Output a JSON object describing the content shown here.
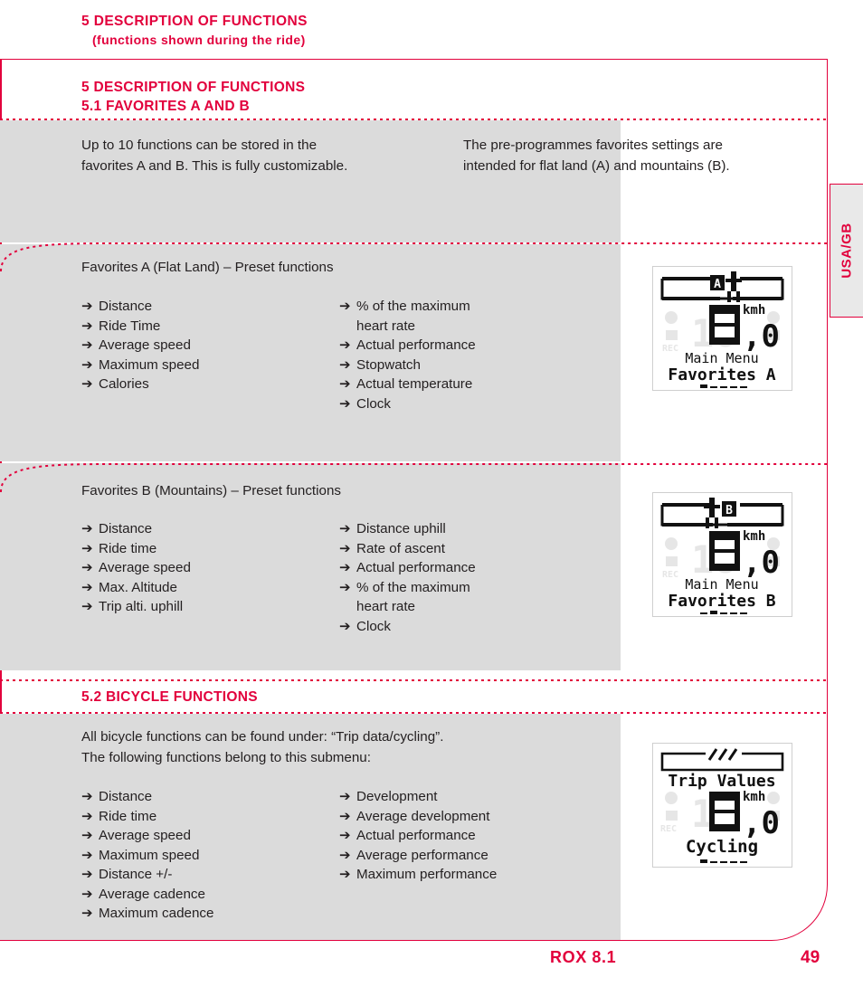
{
  "running_head": {
    "line1": "5 DESCRIPTION OF FUNCTIONS",
    "line2": "(functions shown during the ride)"
  },
  "chapter": {
    "title": "5 DESCRIPTION OF FUNCTIONS",
    "section_51": "5.1 FAVORITES A AND B",
    "section_52": "5.2 BICYCLE FUNCTIONS"
  },
  "intro": {
    "left": "Up to 10 functions can be stored in the\nfavorites A and B. This is fully customizable.",
    "right": "The pre-programmes favorites settings are\nintended for flat land (A) and mountains (B)."
  },
  "favorites_a": {
    "subtitle": "Favorites A (Flat Land) – Preset functions",
    "col1": [
      "Distance",
      "Ride Time",
      "Average speed",
      "Maximum speed",
      "Calories"
    ],
    "col2": [
      "% of the maximum\nheart rate",
      "Actual performance",
      "Stopwatch",
      "Actual temperature",
      "Clock"
    ],
    "lcd": {
      "icon_label": "A",
      "speed_main": "0",
      "speed_dec": ",0",
      "unit": "kmh",
      "line1": "Main Menu",
      "line2": "Favorites A"
    }
  },
  "favorites_b": {
    "subtitle": "Favorites B (Mountains) – Preset functions",
    "col1": [
      "Distance",
      "Ride time",
      "Average speed",
      "Max. Altitude",
      "Trip alti. uphill"
    ],
    "col2": [
      "Distance uphill",
      "Rate of ascent",
      "Actual performance",
      "% of the maximum\nheart rate",
      "Clock"
    ],
    "lcd": {
      "icon_label": "B",
      "speed_main": "0",
      "speed_dec": ",0",
      "unit": "kmh",
      "line1": "Main Menu",
      "line2": "Favorites B"
    }
  },
  "bicycle_functions": {
    "intro": "All bicycle functions can be found under: “Trip data/cycling”.\nThe following functions belong to this submenu:",
    "col1": [
      "Distance",
      "Ride time",
      "Average speed",
      "Maximum speed",
      "Distance +/-",
      "Average cadence",
      "Maximum cadence"
    ],
    "col2": [
      "Development",
      "Average development",
      "Actual performance",
      "Average performance",
      "Maximum performance"
    ],
    "lcd": {
      "speed_main": "0",
      "speed_dec": ",0",
      "unit": "kmh",
      "line1": "Trip Values",
      "line2": "Cycling"
    }
  },
  "side_tab": {
    "label": "USA/GB"
  },
  "footer": {
    "model": "ROX 8.1",
    "page": "49"
  },
  "colors": {
    "accent": "#E2003C",
    "panel": "#DBDBDB",
    "text": "#231F20"
  },
  "arrow_glyph": "➔"
}
